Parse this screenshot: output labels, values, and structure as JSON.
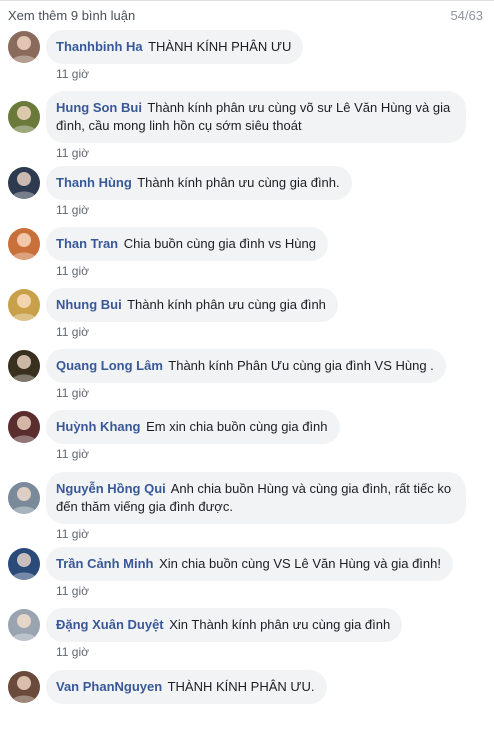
{
  "header": {
    "more_comments": "Xem thêm 9 bình luận",
    "counter": "54/63"
  },
  "comments": [
    {
      "author": "Thanhbinh Ha",
      "text": "THÀNH KÍNH PHÂN ƯU",
      "time": "11 giờ",
      "avatar_color": "#8a6a5a"
    },
    {
      "author": "Hung Son Bui",
      "text": "Thành kính phân ưu cùng võ sư Lê Văn Hùng và gia đình, cầu mong linh hồn cụ sớm siêu thoát",
      "time": "11 giờ",
      "avatar_color": "#6b7a3a"
    },
    {
      "author": "Thanh Hùng",
      "text": "Thành kính phân ưu cùng gia đình.",
      "time": "11 giờ",
      "avatar_color": "#2d3a4f"
    },
    {
      "author": "Than Tran",
      "text": "Chia buồn cùng gia đình vs Hùng",
      "time": "11 giờ",
      "avatar_color": "#c9703a"
    },
    {
      "author": "Nhung Bui",
      "text": "Thành kính phân ưu cùng gia đình",
      "time": "11 giờ",
      "avatar_color": "#c9a04a"
    },
    {
      "author": "Quang Long Lâm",
      "text": "Thành kính Phân Ưu cùng gia đình VS Hùng .",
      "time": "11 giờ",
      "avatar_color": "#3a3020"
    },
    {
      "author": "Huỳnh Khang",
      "text": "Em xin chia buồn cùng gia đình",
      "time": "11 giờ",
      "avatar_color": "#5a2e2e"
    },
    {
      "author": "Nguyễn Hồng Qui",
      "text": "Anh chia buồn Hùng và cùng gia đình, rất tiếc ko đến thăm viếng gia đình được.",
      "time": "11 giờ",
      "avatar_color": "#7a8a9a"
    },
    {
      "author": "Trần Cảnh Minh",
      "text": "Xin chia buồn cùng VS Lê Văn Hùng và gia đình!",
      "time": "11 giờ",
      "avatar_color": "#2a4a7a"
    },
    {
      "author": "Đặng Xuân Duyệt",
      "text": "Xin Thành kính phân ưu cùng gia đình",
      "time": "11 giờ",
      "avatar_color": "#9aa4b0"
    },
    {
      "author": "Van PhanNguyen",
      "text": "THÀNH KÍNH PHÂN ƯU.",
      "time": "",
      "avatar_color": "#6a4a3a"
    }
  ]
}
